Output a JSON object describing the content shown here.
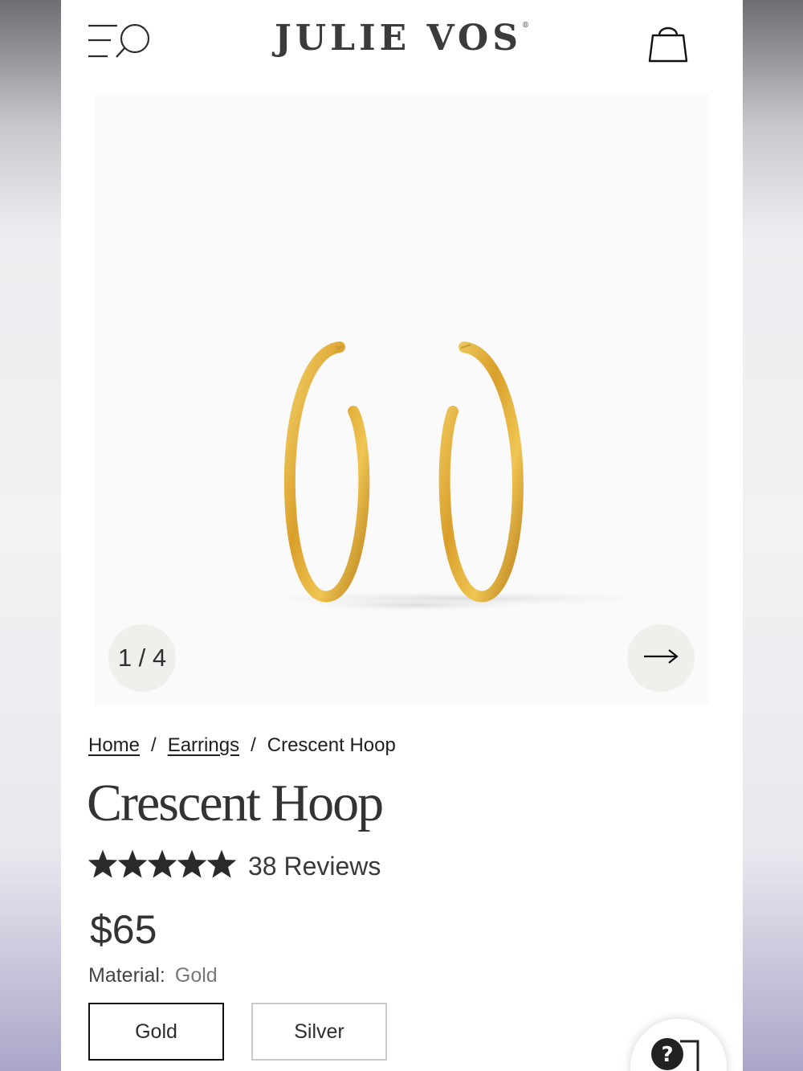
{
  "header": {
    "logo": "JULIE VOS",
    "logo_mark": "®",
    "menu_icon": "menu-search-icon",
    "bag_icon": "shopping-bag-icon"
  },
  "gallery": {
    "counter": "1 / 4",
    "next_icon": "arrow-right-icon"
  },
  "breadcrumb": {
    "items": [
      "Home",
      "Earrings",
      "Crescent Hoop"
    ],
    "separator": "/"
  },
  "product": {
    "title": "Crescent Hoop",
    "rating": 5,
    "reviews": "38 Reviews",
    "price": "$65",
    "material_label": "Material:",
    "material_value": "Gold",
    "options": [
      "Gold",
      "Silver"
    ],
    "selected_option": "Gold"
  },
  "help": {
    "icon": "help-chat-icon",
    "label": "?"
  },
  "colors": {
    "gold": "#d9a531",
    "text": "#333333",
    "gray_btn": "#efefec"
  }
}
